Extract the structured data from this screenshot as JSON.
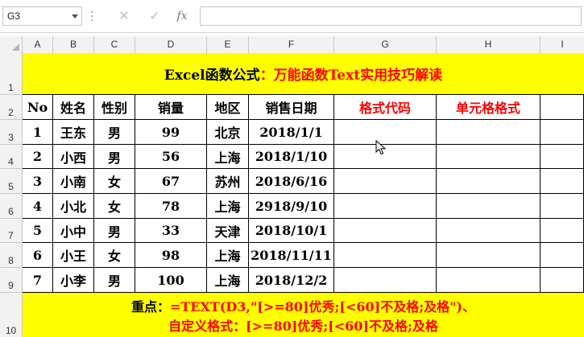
{
  "formula_bar": {
    "name_box": "G3",
    "cancel_icon": "✕",
    "enter_icon": "✓",
    "fx_label": "fx",
    "formula": ""
  },
  "columns": [
    "A",
    "B",
    "C",
    "D",
    "E",
    "F",
    "G",
    "H",
    "I"
  ],
  "rows": [
    "1",
    "2",
    "3",
    "4",
    "5",
    "6",
    "7",
    "8",
    "9",
    "10"
  ],
  "sheet": {
    "title_part1": "Excel函数公式",
    "title_part2": "：万能函数Text实用技巧解读",
    "headers": [
      "No",
      "姓名",
      "性别",
      "销量",
      "地区",
      "销售日期",
      "格式代码",
      "单元格格式"
    ],
    "data": [
      [
        "1",
        "王东",
        "男",
        "99",
        "北京",
        "2018/1/1"
      ],
      [
        "2",
        "小西",
        "男",
        "56",
        "上海",
        "2018/1/10"
      ],
      [
        "3",
        "小南",
        "女",
        "67",
        "苏州",
        "2018/6/16"
      ],
      [
        "4",
        "小北",
        "女",
        "78",
        "上海",
        "2918/9/10"
      ],
      [
        "5",
        "小中",
        "男",
        "33",
        "天津",
        "2018/10/1"
      ],
      [
        "6",
        "小王",
        "女",
        "98",
        "上海",
        "2018/11/11"
      ],
      [
        "7",
        "小李",
        "男",
        "100",
        "上海",
        "2018/12/2"
      ]
    ],
    "note_line1_label": "重点：",
    "note_line1_text": "=TEXT(D3,\"[>=80]优秀;[<60]不及格;及格\")、",
    "note_line2_text": "自定义格式：[>=80]优秀;[<60]不及格;及格"
  },
  "colors": {
    "highlight": "#ffff00",
    "emphasis": "#ff0000",
    "grid_header": "#f2f2f2"
  }
}
